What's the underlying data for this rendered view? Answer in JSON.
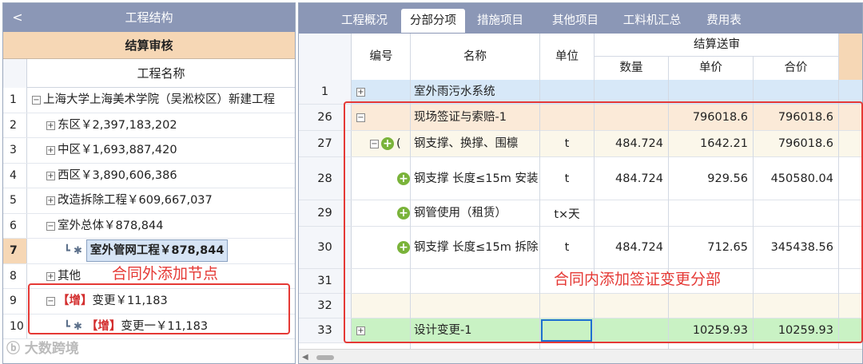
{
  "left_panel": {
    "collapse_label": "<",
    "title": "工程结构",
    "subheader": "结算审核",
    "column_header": "工程名称",
    "rows": [
      {
        "num": "1",
        "toggle": "−",
        "tag": "",
        "text": "上海大学上海美术学院（吴淞校区）新建工程"
      },
      {
        "num": "2",
        "toggle": "+",
        "tag": "",
        "text": "东区￥2,397,183,202"
      },
      {
        "num": "3",
        "toggle": "+",
        "tag": "",
        "text": "中区￥1,693,887,420"
      },
      {
        "num": "4",
        "toggle": "+",
        "tag": "",
        "text": "西区￥3,890,606,386"
      },
      {
        "num": "5",
        "toggle": "+",
        "tag": "",
        "text": "改造拆除工程￥609,667,037"
      },
      {
        "num": "6",
        "toggle": "−",
        "tag": "",
        "text": "室外总体￥878,844"
      },
      {
        "num": "7",
        "toggle": "",
        "tag": "",
        "text": "室外管网工程￥878,844"
      },
      {
        "num": "8",
        "toggle": "+",
        "tag": "",
        "text": "其他"
      },
      {
        "num": "9",
        "toggle": "−",
        "tag": "【增】",
        "text": "变更￥11,183"
      },
      {
        "num": "10",
        "toggle": "",
        "tag": "【增】",
        "text": "变更一￥11,183"
      }
    ]
  },
  "right_panel": {
    "tabs": [
      "工程概况",
      "分部分项",
      "措施项目",
      "其他项目",
      "工料机汇总",
      "费用表"
    ],
    "active_tab": 1,
    "headers": {
      "code": "编号",
      "name": "名称",
      "unit": "单位",
      "group": "结算送审",
      "qty": "数量",
      "price": "单价",
      "total": "合价"
    },
    "rows": [
      {
        "num": "1",
        "toggle": "+",
        "name": "室外雨污水系统",
        "unit": "",
        "qty": "",
        "price": "",
        "total": ""
      },
      {
        "num": "26",
        "toggle": "−",
        "name": "现场签证与索赔-1",
        "unit": "",
        "qty": "",
        "price": "796018.6",
        "total": "796018.6"
      },
      {
        "num": "27",
        "toggle": "−",
        "name": "钢支撑、换撑、围檩",
        "unit": "t",
        "qty": "484.724",
        "price": "1642.21",
        "total": "796018.6"
      },
      {
        "num": "28",
        "toggle": "",
        "name": "钢支撑 长度≤15m 安装",
        "unit": "t",
        "qty": "484.724",
        "price": "929.56",
        "total": "450580.04"
      },
      {
        "num": "29",
        "toggle": "",
        "name": "钢管使用（租赁）",
        "unit": "t×天",
        "qty": "",
        "price": "",
        "total": ""
      },
      {
        "num": "30",
        "toggle": "",
        "name": "钢支撑 长度≤15m 拆除",
        "unit": "t",
        "qty": "484.724",
        "price": "712.65",
        "total": "345438.56"
      },
      {
        "num": "31",
        "toggle": "",
        "name": "",
        "unit": "",
        "qty": "",
        "price": "",
        "total": ""
      },
      {
        "num": "32",
        "toggle": "",
        "name": "",
        "unit": "",
        "qty": "",
        "price": "",
        "total": ""
      },
      {
        "num": "33",
        "toggle": "+",
        "name": "设计变更-1",
        "unit": "",
        "qty": "",
        "price": "10259.93",
        "total": "10259.93"
      }
    ],
    "row27_code_glyph": "(",
    "scroll_left": "◀"
  },
  "annotations": {
    "left": "合同外添加节点",
    "right": "合同内添加签证变更分部"
  },
  "watermark": "大数跨境",
  "colors": {
    "title_bar": "#8b97b6",
    "subheader": "#f6d7b5",
    "row_blue": "#d7e8f8",
    "row_peach": "#fbead8",
    "row_cream": "#fbf7ea",
    "row_green": "#c9f2c4",
    "annotation_red": "#e53935",
    "add_icon_green": "#7ab33a"
  }
}
